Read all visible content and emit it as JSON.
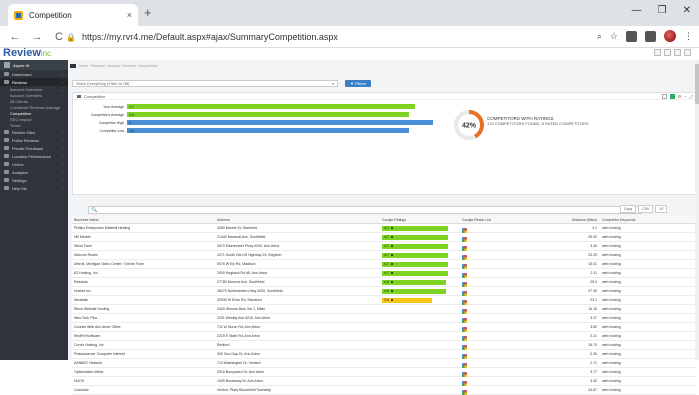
{
  "browser": {
    "tab_title": "Competition",
    "tab_close": "×",
    "new_tab": "+",
    "url": "https://my.rvr4.me/Default.aspx#ajax/SummaryCompetition.aspx",
    "win_min": "—",
    "win_max": "❐",
    "win_close": "✕"
  },
  "app": {
    "logo_main": "Review",
    "logo_accent": "inc"
  },
  "sidebar": {
    "user": "Aspire Hi",
    "items": [
      {
        "label": "Dashboard",
        "type": "top"
      },
      {
        "label": "Reviews",
        "type": "top-sel"
      },
      {
        "label": "Account Overview",
        "type": "sub-head"
      },
      {
        "label": "Account Overview",
        "type": "sub"
      },
      {
        "label": "All Clients",
        "type": "sub"
      },
      {
        "label": "Combined Reviews Average",
        "type": "sub"
      },
      {
        "label": "Competition",
        "type": "sub-active"
      },
      {
        "label": "SEO Impact",
        "type": "sub"
      },
      {
        "label": "Trend",
        "type": "sub"
      },
      {
        "label": "Review Sites",
        "type": "top2"
      },
      {
        "label": "Public Reviews",
        "type": "top2"
      },
      {
        "label": "Private Feedback",
        "type": "top2"
      },
      {
        "label": "Location Performance",
        "type": "top2"
      },
      {
        "label": "Online",
        "type": "top"
      },
      {
        "label": "Analytics",
        "type": "top"
      },
      {
        "label": "Settings",
        "type": "top"
      },
      {
        "label": "Help Me",
        "type": "top"
      }
    ]
  },
  "main": {
    "breadcrumb": "Home › Reviews › Account Overview › Competition",
    "filter_text": "Show Everything (Filter to Off)",
    "filter_button": "▼ Filters",
    "panel_title": "Competition",
    "gauge_value": "42%",
    "gauge_title": "COMPETITORS WITH RATINGS",
    "gauge_sub": "170 COMPETITORS FOUND, 8 RATED COMPETITORS",
    "search_icon": "🔍",
    "export_copy": "Copy",
    "export_csv": "CSV",
    "export_len": "10"
  },
  "chart_data": {
    "type": "bar",
    "categories": [
      "Your Average",
      "Competitor's Average",
      "Competitor High",
      "Competitor Low"
    ],
    "values": [
      4.7,
      4.6,
      5.0,
      4.6
    ],
    "colors": [
      "#7ed321",
      "#7ed321",
      "#4a90d9",
      "#4a90d9"
    ],
    "xlim": [
      0,
      5
    ]
  },
  "table": {
    "headers": [
      "Business Name",
      "Address",
      "Google Ratings",
      "Google Reach List",
      "Distance (Miles)",
      "Competitor Keywords"
    ],
    "rows": [
      {
        "name": "Phillips Enterprises Material Heating",
        "addr": "4050 Marine St, Stamford",
        "rating": 4.7,
        "color": "#7ed321",
        "dist": "4.1",
        "kw": "web hosting"
      },
      {
        "name": "Hill Market",
        "addr": "21440 Mammal Ave, Southfield",
        "rating": 4.7,
        "color": "#7ed321",
        "dist": "25.00",
        "kw": "web hosting"
      },
      {
        "name": "Strick Farm",
        "addr": "2670 Eisenhower Pkwy #200, Ann Arbor",
        "rating": 4.7,
        "color": "#7ed321",
        "dist": "3.40",
        "kw": "web hosting"
      },
      {
        "name": "Marcum Realm",
        "addr": "1071 South Old US Highway 23, Brighton",
        "rating": 4.7,
        "color": "#7ed321",
        "dist": "23.29",
        "kw": "web hosting"
      },
      {
        "name": "Detroit, Michigan Video Center / Online Farm",
        "addr": "5076 W Ely Rd, Madison",
        "rating": 4.7,
        "color": "#7ed321",
        "dist": "15.01",
        "kw": "web hosting"
      },
      {
        "name": "A2 Hosting, Inc.",
        "addr": "2000 Hogback Rd #5, Ann Arbor",
        "rating": 4.7,
        "color": "#7ed321",
        "dist": "2.11",
        "kw": "web hosting"
      },
      {
        "name": "Resolute",
        "addr": "27780 Monrow Ave, Southfield",
        "rating": 4.6,
        "color": "#7ed321",
        "dist": "25.4",
        "kw": "web hosting"
      },
      {
        "name": "Hosted Inc",
        "addr": "26270 Northwestern Hwy #200, Southfield",
        "rating": 4.6,
        "color": "#7ed321",
        "dist": "27.30",
        "kw": "web hosting"
      },
      {
        "name": "Neostate",
        "addr": "20930 W Ends Rd, Stamford",
        "rating": 3.6,
        "color": "#f5c518",
        "dist": "23.1",
        "kw": "web hosting"
      },
      {
        "name": "Rikon Website Hosting",
        "addr": "2440 Winona Blvd, Ibs 1, Milan",
        "rating": null,
        "dist": "15.15",
        "kw": "web hosting"
      },
      {
        "name": "New Tech Plus",
        "addr": "2231 Westby Ave #216, Ann Arbor",
        "rating": null,
        "dist": "3.37",
        "kw": "web hosting"
      },
      {
        "name": "Coursin Web Ann Arbor Office",
        "addr": "711 W Huron Rd, Ann Arbor",
        "rating": null,
        "dist": "3.80",
        "kw": "web hosting"
      },
      {
        "name": "RedFireSoftware",
        "addr": "2215 E State Rd, Ann Arbor",
        "rating": null,
        "dist": "2.21",
        "kw": "web hosting"
      },
      {
        "name": "Corvin Hosting, Inc.",
        "addr": "Redford",
        "rating": null,
        "dist": "15.74",
        "kw": "web hosting"
      },
      {
        "name": "Plateauserver Computer Internet",
        "addr": "900 Geo Gap Dr, Ann Arbor",
        "rating": null,
        "dist": "0.35",
        "kw": "web hosting"
      },
      {
        "name": "AANBEC Network",
        "addr": "713 Washington Dr, Vorland",
        "rating": null,
        "dist": "2.71",
        "kw": "web hosting"
      },
      {
        "name": "Optimization Webs",
        "addr": "2016 Burnyward Dr, Ann Arbor",
        "rating": null,
        "dist": "3.77",
        "kw": "web hosting"
      },
      {
        "name": "NUOS",
        "addr": "1905 Broadway St, Ann Arbor",
        "rating": null,
        "dist": "3.30",
        "kw": "web hosting"
      },
      {
        "name": "Coinsolar",
        "addr": "Vonton, Pkwy Bloomfield Township",
        "rating": null,
        "dist": "24.67",
        "kw": "web hosting"
      }
    ]
  }
}
